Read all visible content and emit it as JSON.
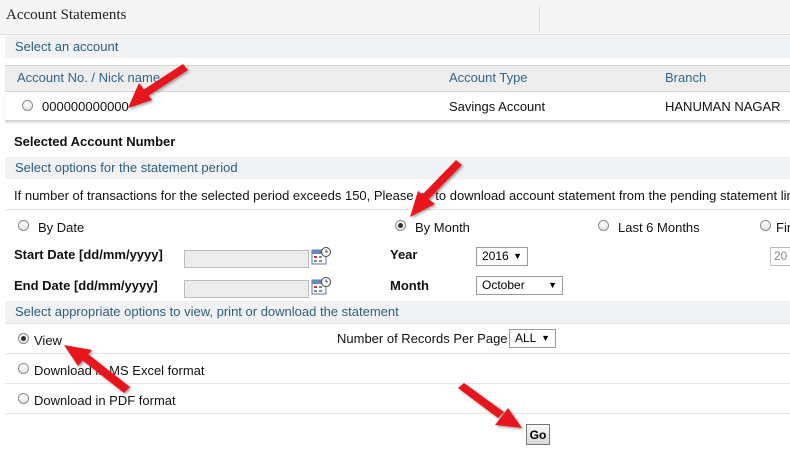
{
  "header": {
    "title": "Account Statements"
  },
  "account_section": {
    "heading": "Select an account",
    "columns": [
      "Account No. / Nick name",
      "Account Type",
      "Branch"
    ],
    "rows": [
      {
        "account": "000000000000",
        "type": "Savings Account",
        "branch": "HANUMAN NAGAR"
      }
    ]
  },
  "selected_account_label": "Selected Account Number",
  "period_section": {
    "heading": "Select options for the statement period",
    "notice": "If number of transactions for the selected period exceeds 150, Please try to download account statement from the pending statement link",
    "options": [
      "By Date",
      "By Month",
      "Last 6 Months",
      "Fin"
    ],
    "selected_option": "By Month",
    "start_date_label": "Start Date [dd/mm/yyyy]",
    "end_date_label": "End Date [dd/mm/yyyy]",
    "year_label": "Year",
    "year_value": "2016",
    "month_label": "Month",
    "month_value": "October",
    "cut_field_value": "20"
  },
  "output_section": {
    "heading": "Select appropriate options to view, print or download the statement",
    "options": [
      "View",
      "Download in MS Excel format",
      "Download in PDF format"
    ],
    "selected_option": "View",
    "records_label": "Number of Records Per Page",
    "records_value": "ALL"
  },
  "go_button": "Go",
  "icons": {
    "calendar": "calendar-icon",
    "annotation": "red-arrow-icon"
  },
  "colors": {
    "heading_text": "#2f5d7c",
    "arrow": "#e8141b"
  }
}
